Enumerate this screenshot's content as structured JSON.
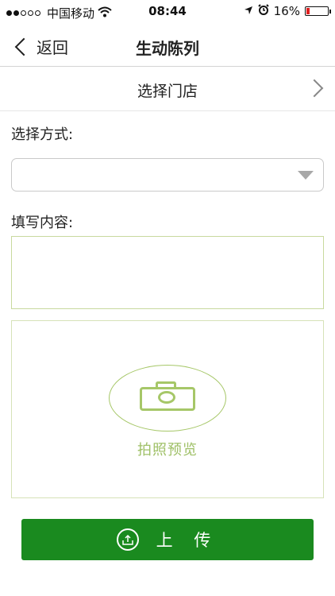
{
  "status_bar": {
    "carrier": "中国移动",
    "time": "08:44",
    "battery": "16%",
    "battery_level": 0.16,
    "signal_strength": 2,
    "icons": [
      "wifi-icon",
      "location-icon",
      "alarm-icon",
      "battery-icon"
    ]
  },
  "nav": {
    "back_label": "返回",
    "title": "生动陈列"
  },
  "store": {
    "label": "选择门店"
  },
  "form": {
    "method_label": "选择方式:",
    "method_value": "",
    "content_label": "填写内容:",
    "content_value": ""
  },
  "photo": {
    "label": "拍照预览"
  },
  "upload": {
    "label": "上 传"
  },
  "colors": {
    "accent_green": "#1a8a1f",
    "photo_green": "#a6c768",
    "battery_low": "#e02020"
  }
}
